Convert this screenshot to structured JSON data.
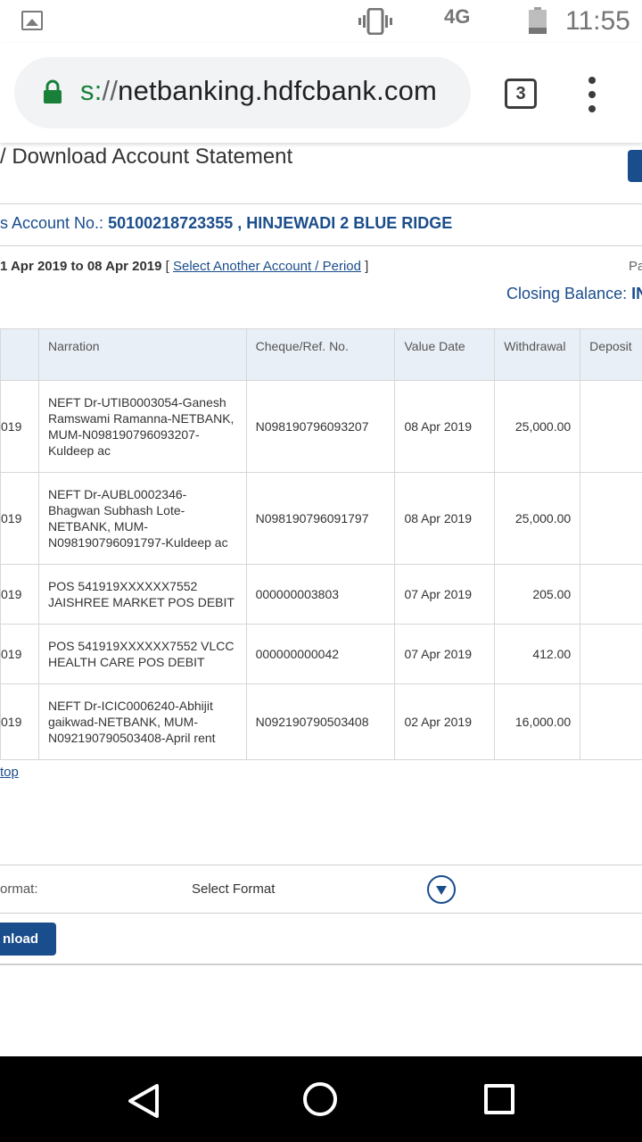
{
  "status_bar": {
    "network": "4G",
    "time": "11:55"
  },
  "browser": {
    "url_scheme": "s:",
    "url_slashes": "//",
    "url_host": "netbanking.hdfcbank.com",
    "tab_count": "3"
  },
  "page": {
    "title": "/ Download Account Statement",
    "account_prefix": "s Account No.: ",
    "account_number": "50100218723355 , HINJEWADI 2 BLUE RIDGE",
    "period_text": "1 Apr 2019 to 08 Apr 2019",
    "bracket_open": " [ ",
    "select_link": "Select Another Account / Period",
    "bracket_close": " ]",
    "page_edge_text": "Pa",
    "closing_label": "Closing Balance: ",
    "closing_value": "IN"
  },
  "table": {
    "headers": [
      "",
      "Narration",
      "Cheque/Ref. No.",
      "Value Date",
      "Withdrawal",
      "Deposit"
    ],
    "rows": [
      {
        "date": "019",
        "narration": "NEFT Dr-UTIB0003054-Ganesh Ramswami Ramanna-NETBANK, MUM-N098190796093207-Kuldeep ac",
        "ref": "N098190796093207",
        "value_date": "08 Apr 2019",
        "withdrawal": "25,000.00",
        "deposit": ""
      },
      {
        "date": "019",
        "narration": "NEFT Dr-AUBL0002346-Bhagwan Subhash Lote-NETBANK, MUM-N098190796091797-Kuldeep ac",
        "ref": "N098190796091797",
        "value_date": "08 Apr 2019",
        "withdrawal": "25,000.00",
        "deposit": ""
      },
      {
        "date": "019",
        "narration": "POS 541919XXXXXX7552 JAISHREE MARKET POS DEBIT",
        "ref": "000000003803",
        "value_date": "07 Apr 2019",
        "withdrawal": "205.00",
        "deposit": ""
      },
      {
        "date": "019",
        "narration": "POS 541919XXXXXX7552 VLCC HEALTH CARE POS DEBIT",
        "ref": "000000000042",
        "value_date": "07 Apr 2019",
        "withdrawal": "412.00",
        "deposit": ""
      },
      {
        "date": "019",
        "narration": "NEFT Dr-ICIC0006240-Abhijit gaikwad-NETBANK, MUM-N092190790503408-April rent",
        "ref": "N092190790503408",
        "value_date": "02 Apr 2019",
        "withdrawal": "16,000.00",
        "deposit": ""
      }
    ]
  },
  "footer": {
    "top_link": "top",
    "format_label": "ormat:",
    "format_select": "Select Format",
    "download_label": "nload"
  },
  "icons": {
    "status_left": "image-icon",
    "status_vibrate": "vibrate-icon",
    "status_battery": "battery-icon",
    "lock": "lock-icon",
    "menu": "more-vert-icon",
    "printer": "printer-icon",
    "dropdown": "chevron-down-circle-icon",
    "nav_back": "back-icon",
    "nav_home": "home-icon",
    "nav_recent": "recent-apps-icon"
  },
  "colors": {
    "brand_blue": "#1a4d8c",
    "header_bg": "#e9eff6",
    "secure_green": "#188038"
  }
}
